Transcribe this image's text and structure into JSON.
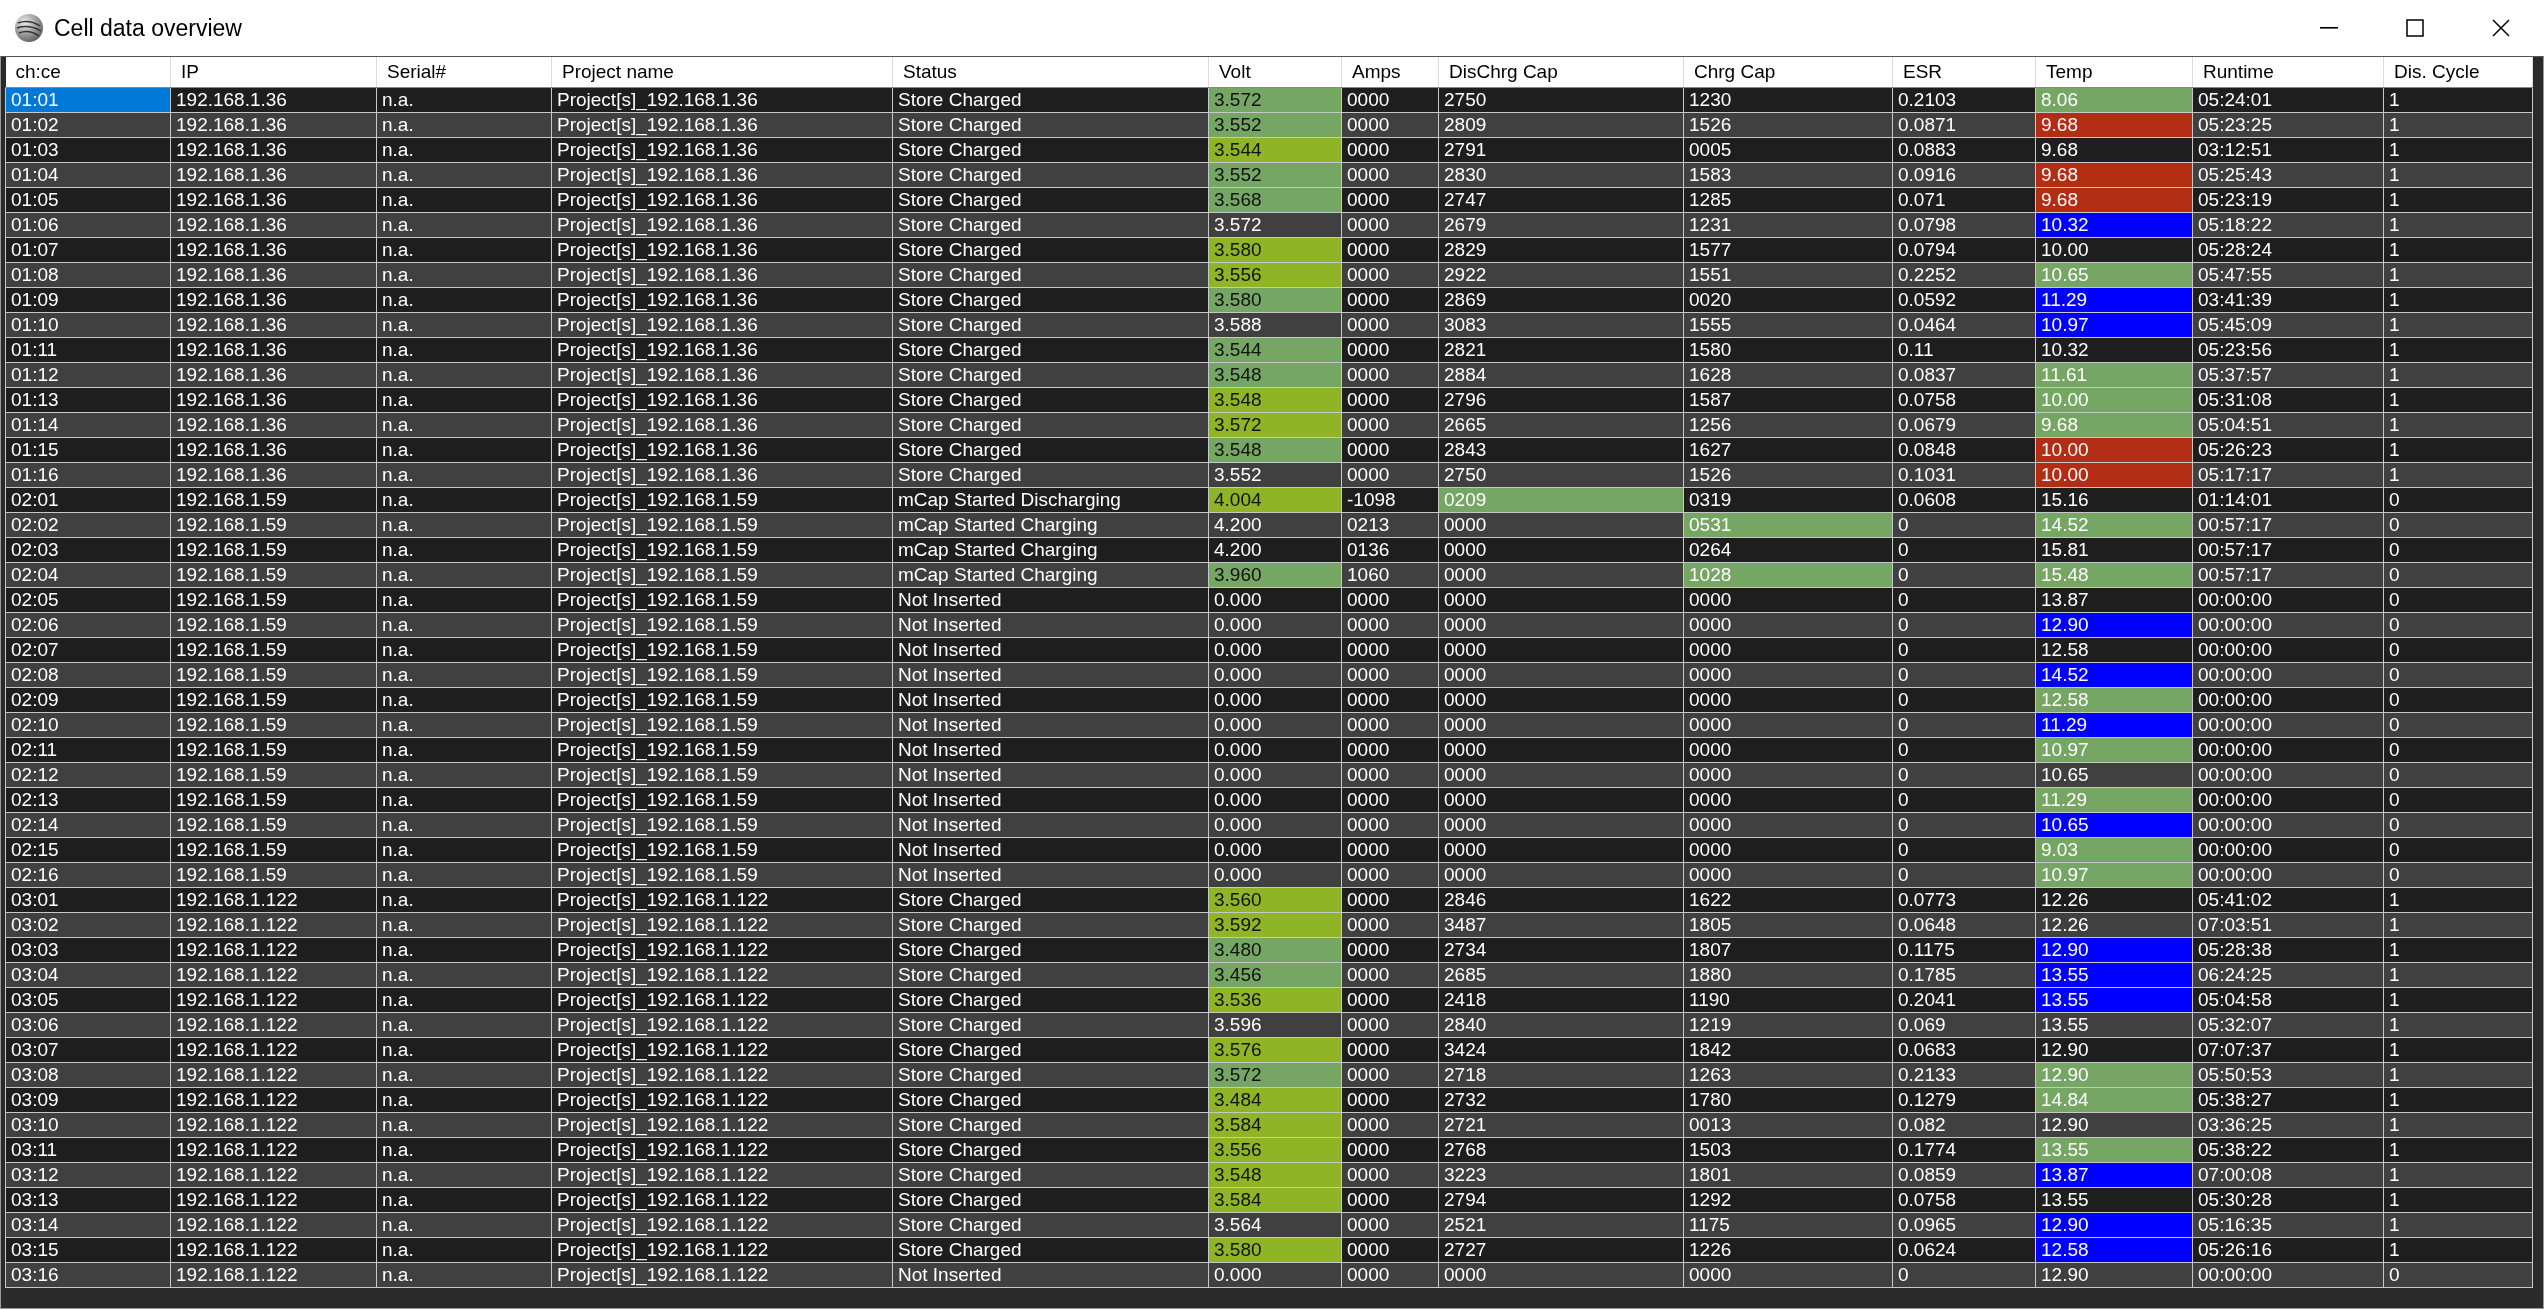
{
  "window": {
    "title": "Cell data overview"
  },
  "table": {
    "columns": [
      "ch:ce",
      "IP",
      "Serial#",
      "Project name",
      "Status",
      "Volt",
      "Amps",
      "DisChrg Cap",
      "Chrg Cap",
      "ESR",
      "Temp",
      "Runtime",
      "Dis. Cycle"
    ],
    "rows": [
      {
        "selected": true,
        "cells": [
          "01:01",
          "192.168.1.36",
          "n.a.",
          "Project[s]_192.168.1.36",
          "Store Charged",
          {
            "text": "3.572",
            "color": "#76a664"
          },
          "0000",
          "2750",
          "1230",
          "0.2103",
          {
            "text": "8.06",
            "color": "#76a664"
          },
          "05:24:01",
          "1"
        ]
      },
      {
        "selected": false,
        "cells": [
          "01:02",
          "192.168.1.36",
          "n.a.",
          "Project[s]_192.168.1.36",
          "Store Charged",
          {
            "text": "3.552",
            "color": "#76a664"
          },
          "0000",
          "2809",
          "1526",
          "0.0871",
          {
            "text": "9.68",
            "color": "#b22d14"
          },
          "05:23:25",
          "1"
        ]
      },
      {
        "selected": false,
        "cells": [
          "01:03",
          "192.168.1.36",
          "n.a.",
          "Project[s]_192.168.1.36",
          "Store Charged",
          {
            "text": "3.544",
            "color": "#8fb526"
          },
          "0000",
          "2791",
          "0005",
          "0.0883",
          "9.68",
          "03:12:51",
          "1"
        ]
      },
      {
        "selected": false,
        "cells": [
          "01:04",
          "192.168.1.36",
          "n.a.",
          "Project[s]_192.168.1.36",
          "Store Charged",
          {
            "text": "3.552",
            "color": "#76a664"
          },
          "0000",
          "2830",
          "1583",
          "0.0916",
          {
            "text": "9.68",
            "color": "#b22d14"
          },
          "05:25:43",
          "1"
        ]
      },
      {
        "selected": false,
        "cells": [
          "01:05",
          "192.168.1.36",
          "n.a.",
          "Project[s]_192.168.1.36",
          "Store Charged",
          {
            "text": "3.568",
            "color": "#76a664"
          },
          "0000",
          "2747",
          "1285",
          "0.071",
          {
            "text": "9.68",
            "color": "#b22d14"
          },
          "05:23:19",
          "1"
        ]
      },
      {
        "selected": false,
        "cells": [
          "01:06",
          "192.168.1.36",
          "n.a.",
          "Project[s]_192.168.1.36",
          "Store Charged",
          "3.572",
          "0000",
          "2679",
          "1231",
          "0.0798",
          {
            "text": "10.32",
            "color": "#0000ff"
          },
          "05:18:22",
          "1"
        ]
      },
      {
        "selected": false,
        "cells": [
          "01:07",
          "192.168.1.36",
          "n.a.",
          "Project[s]_192.168.1.36",
          "Store Charged",
          {
            "text": "3.580",
            "color": "#8fb526"
          },
          "0000",
          "2829",
          "1577",
          "0.0794",
          "10.00",
          "05:28:24",
          "1"
        ]
      },
      {
        "selected": false,
        "cells": [
          "01:08",
          "192.168.1.36",
          "n.a.",
          "Project[s]_192.168.1.36",
          "Store Charged",
          {
            "text": "3.556",
            "color": "#8fb526"
          },
          "0000",
          "2922",
          "1551",
          "0.2252",
          {
            "text": "10.65",
            "color": "#76a664"
          },
          "05:47:55",
          "1"
        ]
      },
      {
        "selected": false,
        "cells": [
          "01:09",
          "192.168.1.36",
          "n.a.",
          "Project[s]_192.168.1.36",
          "Store Charged",
          {
            "text": "3.580",
            "color": "#76a664"
          },
          "0000",
          "2869",
          "0020",
          "0.0592",
          {
            "text": "11.29",
            "color": "#0000ff"
          },
          "03:41:39",
          "1"
        ]
      },
      {
        "selected": false,
        "cells": [
          "01:10",
          "192.168.1.36",
          "n.a.",
          "Project[s]_192.168.1.36",
          "Store Charged",
          "3.588",
          "0000",
          "3083",
          "1555",
          "0.0464",
          {
            "text": "10.97",
            "color": "#0000ff"
          },
          "05:45:09",
          "1"
        ]
      },
      {
        "selected": false,
        "cells": [
          "01:11",
          "192.168.1.36",
          "n.a.",
          "Project[s]_192.168.1.36",
          "Store Charged",
          {
            "text": "3.544",
            "color": "#76a664"
          },
          "0000",
          "2821",
          "1580",
          "0.11",
          "10.32",
          "05:23:56",
          "1"
        ]
      },
      {
        "selected": false,
        "cells": [
          "01:12",
          "192.168.1.36",
          "n.a.",
          "Project[s]_192.168.1.36",
          "Store Charged",
          {
            "text": "3.548",
            "color": "#76a664"
          },
          "0000",
          "2884",
          "1628",
          "0.0837",
          {
            "text": "11.61",
            "color": "#76a664"
          },
          "05:37:57",
          "1"
        ]
      },
      {
        "selected": false,
        "cells": [
          "01:13",
          "192.168.1.36",
          "n.a.",
          "Project[s]_192.168.1.36",
          "Store Charged",
          {
            "text": "3.548",
            "color": "#8fb526"
          },
          "0000",
          "2796",
          "1587",
          "0.0758",
          {
            "text": "10.00",
            "color": "#76a664"
          },
          "05:31:08",
          "1"
        ]
      },
      {
        "selected": false,
        "cells": [
          "01:14",
          "192.168.1.36",
          "n.a.",
          "Project[s]_192.168.1.36",
          "Store Charged",
          {
            "text": "3.572",
            "color": "#8fb526"
          },
          "0000",
          "2665",
          "1256",
          "0.0679",
          {
            "text": "9.68",
            "color": "#76a664"
          },
          "05:04:51",
          "1"
        ]
      },
      {
        "selected": false,
        "cells": [
          "01:15",
          "192.168.1.36",
          "n.a.",
          "Project[s]_192.168.1.36",
          "Store Charged",
          {
            "text": "3.548",
            "color": "#76a664"
          },
          "0000",
          "2843",
          "1627",
          "0.0848",
          {
            "text": "10.00",
            "color": "#b22d14"
          },
          "05:26:23",
          "1"
        ]
      },
      {
        "selected": false,
        "cells": [
          "01:16",
          "192.168.1.36",
          "n.a.",
          "Project[s]_192.168.1.36",
          "Store Charged",
          "3.552",
          "0000",
          "2750",
          "1526",
          "0.1031",
          {
            "text": "10.00",
            "color": "#b22d14"
          },
          "05:17:17",
          "1"
        ]
      },
      {
        "selected": false,
        "cells": [
          "02:01",
          "192.168.1.59",
          "n.a.",
          "Project[s]_192.168.1.59",
          "mCap Started Discharging",
          {
            "text": "4.004",
            "color": "#8fb526"
          },
          "-1098",
          {
            "text": "0209",
            "color": "#76a664"
          },
          "0319",
          "0.0608",
          "15.16",
          "01:14:01",
          "0"
        ]
      },
      {
        "selected": false,
        "cells": [
          "02:02",
          "192.168.1.59",
          "n.a.",
          "Project[s]_192.168.1.59",
          "mCap Started Charging",
          "4.200",
          "0213",
          "0000",
          {
            "text": "0531",
            "color": "#76a664"
          },
          "0",
          {
            "text": "14.52",
            "color": "#76a664"
          },
          "00:57:17",
          "0"
        ]
      },
      {
        "selected": false,
        "cells": [
          "02:03",
          "192.168.1.59",
          "n.a.",
          "Project[s]_192.168.1.59",
          "mCap Started Charging",
          "4.200",
          "0136",
          "0000",
          "0264",
          "0",
          "15.81",
          "00:57:17",
          "0"
        ]
      },
      {
        "selected": false,
        "cells": [
          "02:04",
          "192.168.1.59",
          "n.a.",
          "Project[s]_192.168.1.59",
          "mCap Started Charging",
          {
            "text": "3.960",
            "color": "#76a664"
          },
          "1060",
          "0000",
          {
            "text": "1028",
            "color": "#76a664"
          },
          "0",
          {
            "text": "15.48",
            "color": "#76a664"
          },
          "00:57:17",
          "0"
        ]
      },
      {
        "selected": false,
        "cells": [
          "02:05",
          "192.168.1.59",
          "n.a.",
          "Project[s]_192.168.1.59",
          "Not Inserted",
          "0.000",
          "0000",
          "0000",
          "0000",
          "0",
          "13.87",
          "00:00:00",
          "0"
        ]
      },
      {
        "selected": false,
        "cells": [
          "02:06",
          "192.168.1.59",
          "n.a.",
          "Project[s]_192.168.1.59",
          "Not Inserted",
          "0.000",
          "0000",
          "0000",
          "0000",
          "0",
          {
            "text": "12.90",
            "color": "#0000ff"
          },
          "00:00:00",
          "0"
        ]
      },
      {
        "selected": false,
        "cells": [
          "02:07",
          "192.168.1.59",
          "n.a.",
          "Project[s]_192.168.1.59",
          "Not Inserted",
          "0.000",
          "0000",
          "0000",
          "0000",
          "0",
          "12.58",
          "00:00:00",
          "0"
        ]
      },
      {
        "selected": false,
        "cells": [
          "02:08",
          "192.168.1.59",
          "n.a.",
          "Project[s]_192.168.1.59",
          "Not Inserted",
          "0.000",
          "0000",
          "0000",
          "0000",
          "0",
          {
            "text": "14.52",
            "color": "#0000ff"
          },
          "00:00:00",
          "0"
        ]
      },
      {
        "selected": false,
        "cells": [
          "02:09",
          "192.168.1.59",
          "n.a.",
          "Project[s]_192.168.1.59",
          "Not Inserted",
          "0.000",
          "0000",
          "0000",
          "0000",
          "0",
          {
            "text": "12.58",
            "color": "#76a664"
          },
          "00:00:00",
          "0"
        ]
      },
      {
        "selected": false,
        "cells": [
          "02:10",
          "192.168.1.59",
          "n.a.",
          "Project[s]_192.168.1.59",
          "Not Inserted",
          "0.000",
          "0000",
          "0000",
          "0000",
          "0",
          {
            "text": "11.29",
            "color": "#0000ff"
          },
          "00:00:00",
          "0"
        ]
      },
      {
        "selected": false,
        "cells": [
          "02:11",
          "192.168.1.59",
          "n.a.",
          "Project[s]_192.168.1.59",
          "Not Inserted",
          "0.000",
          "0000",
          "0000",
          "0000",
          "0",
          {
            "text": "10.97",
            "color": "#76a664"
          },
          "00:00:00",
          "0"
        ]
      },
      {
        "selected": false,
        "cells": [
          "02:12",
          "192.168.1.59",
          "n.a.",
          "Project[s]_192.168.1.59",
          "Not Inserted",
          "0.000",
          "0000",
          "0000",
          "0000",
          "0",
          "10.65",
          "00:00:00",
          "0"
        ]
      },
      {
        "selected": false,
        "cells": [
          "02:13",
          "192.168.1.59",
          "n.a.",
          "Project[s]_192.168.1.59",
          "Not Inserted",
          "0.000",
          "0000",
          "0000",
          "0000",
          "0",
          {
            "text": "11.29",
            "color": "#76a664"
          },
          "00:00:00",
          "0"
        ]
      },
      {
        "selected": false,
        "cells": [
          "02:14",
          "192.168.1.59",
          "n.a.",
          "Project[s]_192.168.1.59",
          "Not Inserted",
          "0.000",
          "0000",
          "0000",
          "0000",
          "0",
          {
            "text": "10.65",
            "color": "#0000ff"
          },
          "00:00:00",
          "0"
        ]
      },
      {
        "selected": false,
        "cells": [
          "02:15",
          "192.168.1.59",
          "n.a.",
          "Project[s]_192.168.1.59",
          "Not Inserted",
          "0.000",
          "0000",
          "0000",
          "0000",
          "0",
          {
            "text": "9.03",
            "color": "#76a664"
          },
          "00:00:00",
          "0"
        ]
      },
      {
        "selected": false,
        "cells": [
          "02:16",
          "192.168.1.59",
          "n.a.",
          "Project[s]_192.168.1.59",
          "Not Inserted",
          "0.000",
          "0000",
          "0000",
          "0000",
          "0",
          {
            "text": "10.97",
            "color": "#76a664"
          },
          "00:00:00",
          "0"
        ]
      },
      {
        "selected": false,
        "cells": [
          "03:01",
          "192.168.1.122",
          "n.a.",
          "Project[s]_192.168.1.122",
          "Store Charged",
          {
            "text": "3.560",
            "color": "#8fb526"
          },
          "0000",
          "2846",
          "1622",
          "0.0773",
          "12.26",
          "05:41:02",
          "1"
        ]
      },
      {
        "selected": false,
        "cells": [
          "03:02",
          "192.168.1.122",
          "n.a.",
          "Project[s]_192.168.1.122",
          "Store Charged",
          {
            "text": "3.592",
            "color": "#8fb526"
          },
          "0000",
          "3487",
          "1805",
          "0.0648",
          "12.26",
          "07:03:51",
          "1"
        ]
      },
      {
        "selected": false,
        "cells": [
          "03:03",
          "192.168.1.122",
          "n.a.",
          "Project[s]_192.168.1.122",
          "Store Charged",
          {
            "text": "3.480",
            "color": "#76a664"
          },
          "0000",
          "2734",
          "1807",
          "0.1175",
          {
            "text": "12.90",
            "color": "#0000ff"
          },
          "05:28:38",
          "1"
        ]
      },
      {
        "selected": false,
        "cells": [
          "03:04",
          "192.168.1.122",
          "n.a.",
          "Project[s]_192.168.1.122",
          "Store Charged",
          {
            "text": "3.456",
            "color": "#76a664"
          },
          "0000",
          "2685",
          "1880",
          "0.1785",
          {
            "text": "13.55",
            "color": "#0000ff"
          },
          "06:24:25",
          "1"
        ]
      },
      {
        "selected": false,
        "cells": [
          "03:05",
          "192.168.1.122",
          "n.a.",
          "Project[s]_192.168.1.122",
          "Store Charged",
          {
            "text": "3.536",
            "color": "#8fb526"
          },
          "0000",
          "2418",
          "1190",
          "0.2041",
          {
            "text": "13.55",
            "color": "#0000ff"
          },
          "05:04:58",
          "1"
        ]
      },
      {
        "selected": false,
        "cells": [
          "03:06",
          "192.168.1.122",
          "n.a.",
          "Project[s]_192.168.1.122",
          "Store Charged",
          "3.596",
          "0000",
          "2840",
          "1219",
          "0.069",
          "13.55",
          "05:32:07",
          "1"
        ]
      },
      {
        "selected": false,
        "cells": [
          "03:07",
          "192.168.1.122",
          "n.a.",
          "Project[s]_192.168.1.122",
          "Store Charged",
          {
            "text": "3.576",
            "color": "#8fb526"
          },
          "0000",
          "3424",
          "1842",
          "0.0683",
          "12.90",
          "07:07:37",
          "1"
        ]
      },
      {
        "selected": false,
        "cells": [
          "03:08",
          "192.168.1.122",
          "n.a.",
          "Project[s]_192.168.1.122",
          "Store Charged",
          {
            "text": "3.572",
            "color": "#76a664"
          },
          "0000",
          "2718",
          "1263",
          "0.2133",
          {
            "text": "12.90",
            "color": "#76a664"
          },
          "05:50:53",
          "1"
        ]
      },
      {
        "selected": false,
        "cells": [
          "03:09",
          "192.168.1.122",
          "n.a.",
          "Project[s]_192.168.1.122",
          "Store Charged",
          {
            "text": "3.484",
            "color": "#8fb526"
          },
          "0000",
          "2732",
          "1780",
          "0.1279",
          {
            "text": "14.84",
            "color": "#76a664"
          },
          "05:38:27",
          "1"
        ]
      },
      {
        "selected": false,
        "cells": [
          "03:10",
          "192.168.1.122",
          "n.a.",
          "Project[s]_192.168.1.122",
          "Store Charged",
          {
            "text": "3.584",
            "color": "#8fb526"
          },
          "0000",
          "2721",
          "0013",
          "0.082",
          "12.90",
          "03:36:25",
          "1"
        ]
      },
      {
        "selected": false,
        "cells": [
          "03:11",
          "192.168.1.122",
          "n.a.",
          "Project[s]_192.168.1.122",
          "Store Charged",
          {
            "text": "3.556",
            "color": "#8fb526"
          },
          "0000",
          "2768",
          "1503",
          "0.1774",
          {
            "text": "13.55",
            "color": "#76a664"
          },
          "05:38:22",
          "1"
        ]
      },
      {
        "selected": false,
        "cells": [
          "03:12",
          "192.168.1.122",
          "n.a.",
          "Project[s]_192.168.1.122",
          "Store Charged",
          {
            "text": "3.548",
            "color": "#8fb526"
          },
          "0000",
          "3223",
          "1801",
          "0.0859",
          {
            "text": "13.87",
            "color": "#0000ff"
          },
          "07:00:08",
          "1"
        ]
      },
      {
        "selected": false,
        "cells": [
          "03:13",
          "192.168.1.122",
          "n.a.",
          "Project[s]_192.168.1.122",
          "Store Charged",
          {
            "text": "3.584",
            "color": "#8fb526"
          },
          "0000",
          "2794",
          "1292",
          "0.0758",
          "13.55",
          "05:30:28",
          "1"
        ]
      },
      {
        "selected": false,
        "cells": [
          "03:14",
          "192.168.1.122",
          "n.a.",
          "Project[s]_192.168.1.122",
          "Store Charged",
          "3.564",
          "0000",
          "2521",
          "1175",
          "0.0965",
          {
            "text": "12.90",
            "color": "#0000ff"
          },
          "05:16:35",
          "1"
        ]
      },
      {
        "selected": false,
        "cells": [
          "03:15",
          "192.168.1.122",
          "n.a.",
          "Project[s]_192.168.1.122",
          "Store Charged",
          {
            "text": "3.580",
            "color": "#8fb526"
          },
          "0000",
          "2727",
          "1226",
          "0.0624",
          {
            "text": "12.58",
            "color": "#0000ff"
          },
          "05:26:16",
          "1"
        ]
      },
      {
        "selected": false,
        "cells": [
          "03:16",
          "192.168.1.122",
          "n.a.",
          "Project[s]_192.168.1.122",
          "Not Inserted",
          "0.000",
          "0000",
          "0000",
          "0000",
          "0",
          "12.90",
          "00:00:00",
          "0"
        ]
      }
    ]
  }
}
